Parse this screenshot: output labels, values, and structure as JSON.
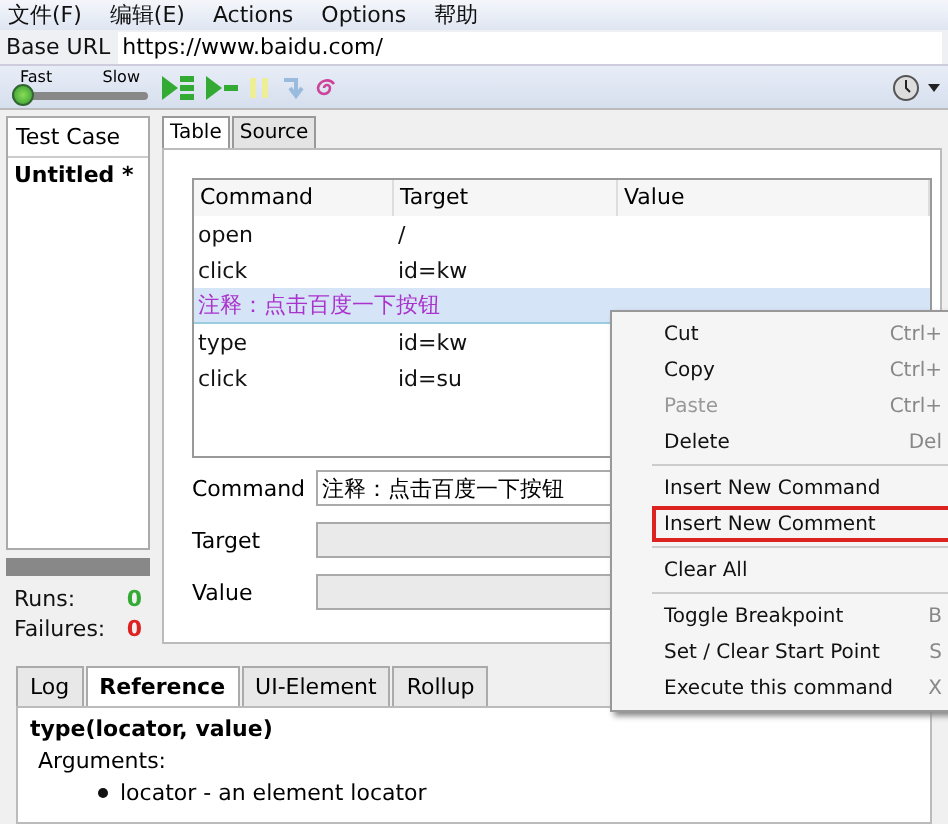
{
  "menu_bar": [
    "文件(F)",
    "编辑(E)",
    "Actions",
    "Options",
    "帮助"
  ],
  "base_url": {
    "label": "Base URL",
    "value": "https://www.baidu.com/"
  },
  "speed": {
    "fast_label": "Fast",
    "slow_label": "Slow",
    "level": 0
  },
  "test_case_panel": {
    "title": "Test Case",
    "items": [
      {
        "label": "Untitled *",
        "selected": true
      }
    ],
    "progress": {
      "level": 0
    },
    "runs_label": "Runs:",
    "runs": "0",
    "failures_label": "Failures:",
    "failures": "0"
  },
  "editor_tabs": [
    {
      "label": "Table",
      "selected": true
    },
    {
      "label": "Source",
      "selected": false
    }
  ],
  "table": {
    "columns": [
      "Command",
      "Target",
      "Value"
    ],
    "rows": [
      {
        "kind": "command",
        "cells": [
          "open",
          "/"
        ],
        "selected": false
      },
      {
        "kind": "command",
        "cells": [
          "click",
          "id=kw"
        ],
        "selected": false
      },
      {
        "kind": "comment",
        "cells": [
          "注释：点击百度一下按钮"
        ],
        "selected": true
      },
      {
        "kind": "command",
        "cells": [
          "type",
          "id=kw"
        ],
        "selected": false
      },
      {
        "kind": "command",
        "cells": [
          "click",
          "id=su"
        ],
        "selected": false
      }
    ]
  },
  "fields": [
    {
      "label": "Command",
      "value": "注释：点击百度一下按钮",
      "disabled": false
    },
    {
      "label": "Target",
      "disabled": true
    },
    {
      "label": "Value",
      "disabled": true
    }
  ],
  "context_menu": [
    {
      "kind": "item",
      "label": "Cut",
      "shortcut": "Ctrl+",
      "disabled": false,
      "highlighted": false
    },
    {
      "kind": "item",
      "label": "Copy",
      "shortcut": "Ctrl+",
      "disabled": false,
      "highlighted": false
    },
    {
      "kind": "item",
      "label": "Paste",
      "shortcut": "Ctrl+",
      "disabled": true,
      "highlighted": false
    },
    {
      "kind": "item",
      "label": "Delete",
      "shortcut": "Del",
      "disabled": false,
      "highlighted": false
    },
    {
      "kind": "separator"
    },
    {
      "kind": "item",
      "label": "Insert New Command",
      "disabled": false,
      "highlighted": false
    },
    {
      "kind": "item",
      "label": "Insert New Comment",
      "disabled": false,
      "highlighted": true
    },
    {
      "kind": "separator"
    },
    {
      "kind": "item",
      "label": "Clear All",
      "disabled": false,
      "highlighted": false
    },
    {
      "kind": "separator"
    },
    {
      "kind": "item",
      "label": "Toggle Breakpoint",
      "shortcut": "B",
      "disabled": false,
      "highlighted": false
    },
    {
      "kind": "item",
      "label": "Set / Clear Start Point",
      "shortcut": "S",
      "disabled": false,
      "highlighted": false
    },
    {
      "kind": "item",
      "label": "Execute this command",
      "shortcut": "X",
      "disabled": false,
      "highlighted": false
    }
  ],
  "bottom_tabs": [
    {
      "label": "Log",
      "selected": false
    },
    {
      "label": "Reference",
      "selected": true
    },
    {
      "label": "UI-Element",
      "selected": false
    },
    {
      "label": "Rollup",
      "selected": false
    }
  ],
  "reference": {
    "signature": "type(locator, value)",
    "arguments_label": "Arguments:",
    "arguments": [
      "locator - an element locator"
    ]
  }
}
